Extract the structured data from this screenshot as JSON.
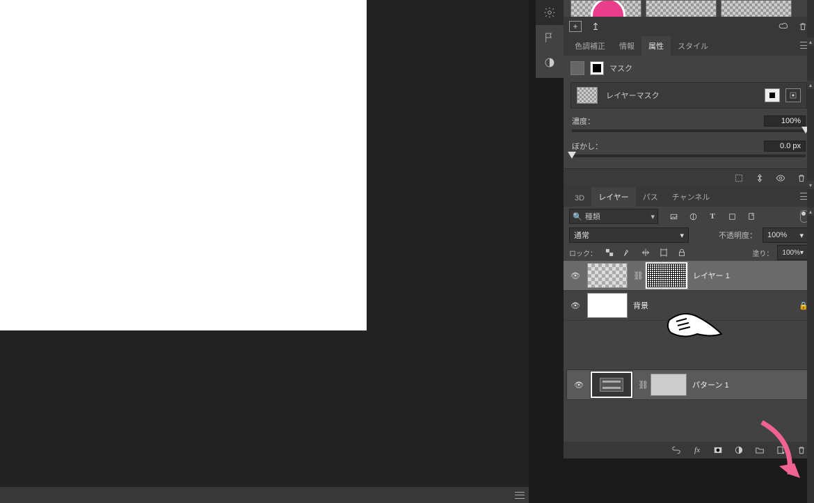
{
  "library": {
    "add_tooltip": "+",
    "upload_tooltip": "↥"
  },
  "tabs_props": {
    "color": "色調補正",
    "info": "情報",
    "props": "属性",
    "styles": "スタイル"
  },
  "props": {
    "mask_label": "マスク",
    "layer_mask_label": "レイヤーマスク",
    "density_label": "濃度：",
    "density_value": "100%",
    "feather_label": "ぼかし：",
    "feather_value": "0.0 px"
  },
  "tabs_layers": {
    "three_d": "3D",
    "layers": "レイヤー",
    "paths": "パス",
    "channels": "チャンネル"
  },
  "layers_panel": {
    "filter_placeholder": "種類",
    "blend_mode": "通常",
    "opacity_label": "不透明度：",
    "opacity_value": "100%",
    "lock_label": "ロック：",
    "fill_label": "塗り：",
    "fill_value": "100%",
    "items": [
      {
        "name": "レイヤー 1",
        "selected": true,
        "has_mask": true,
        "thumb": "check",
        "locked": false
      },
      {
        "name": "背景",
        "selected": false,
        "has_mask": false,
        "thumb": "white",
        "locked": true
      }
    ],
    "pattern_name": "パターン 1"
  }
}
